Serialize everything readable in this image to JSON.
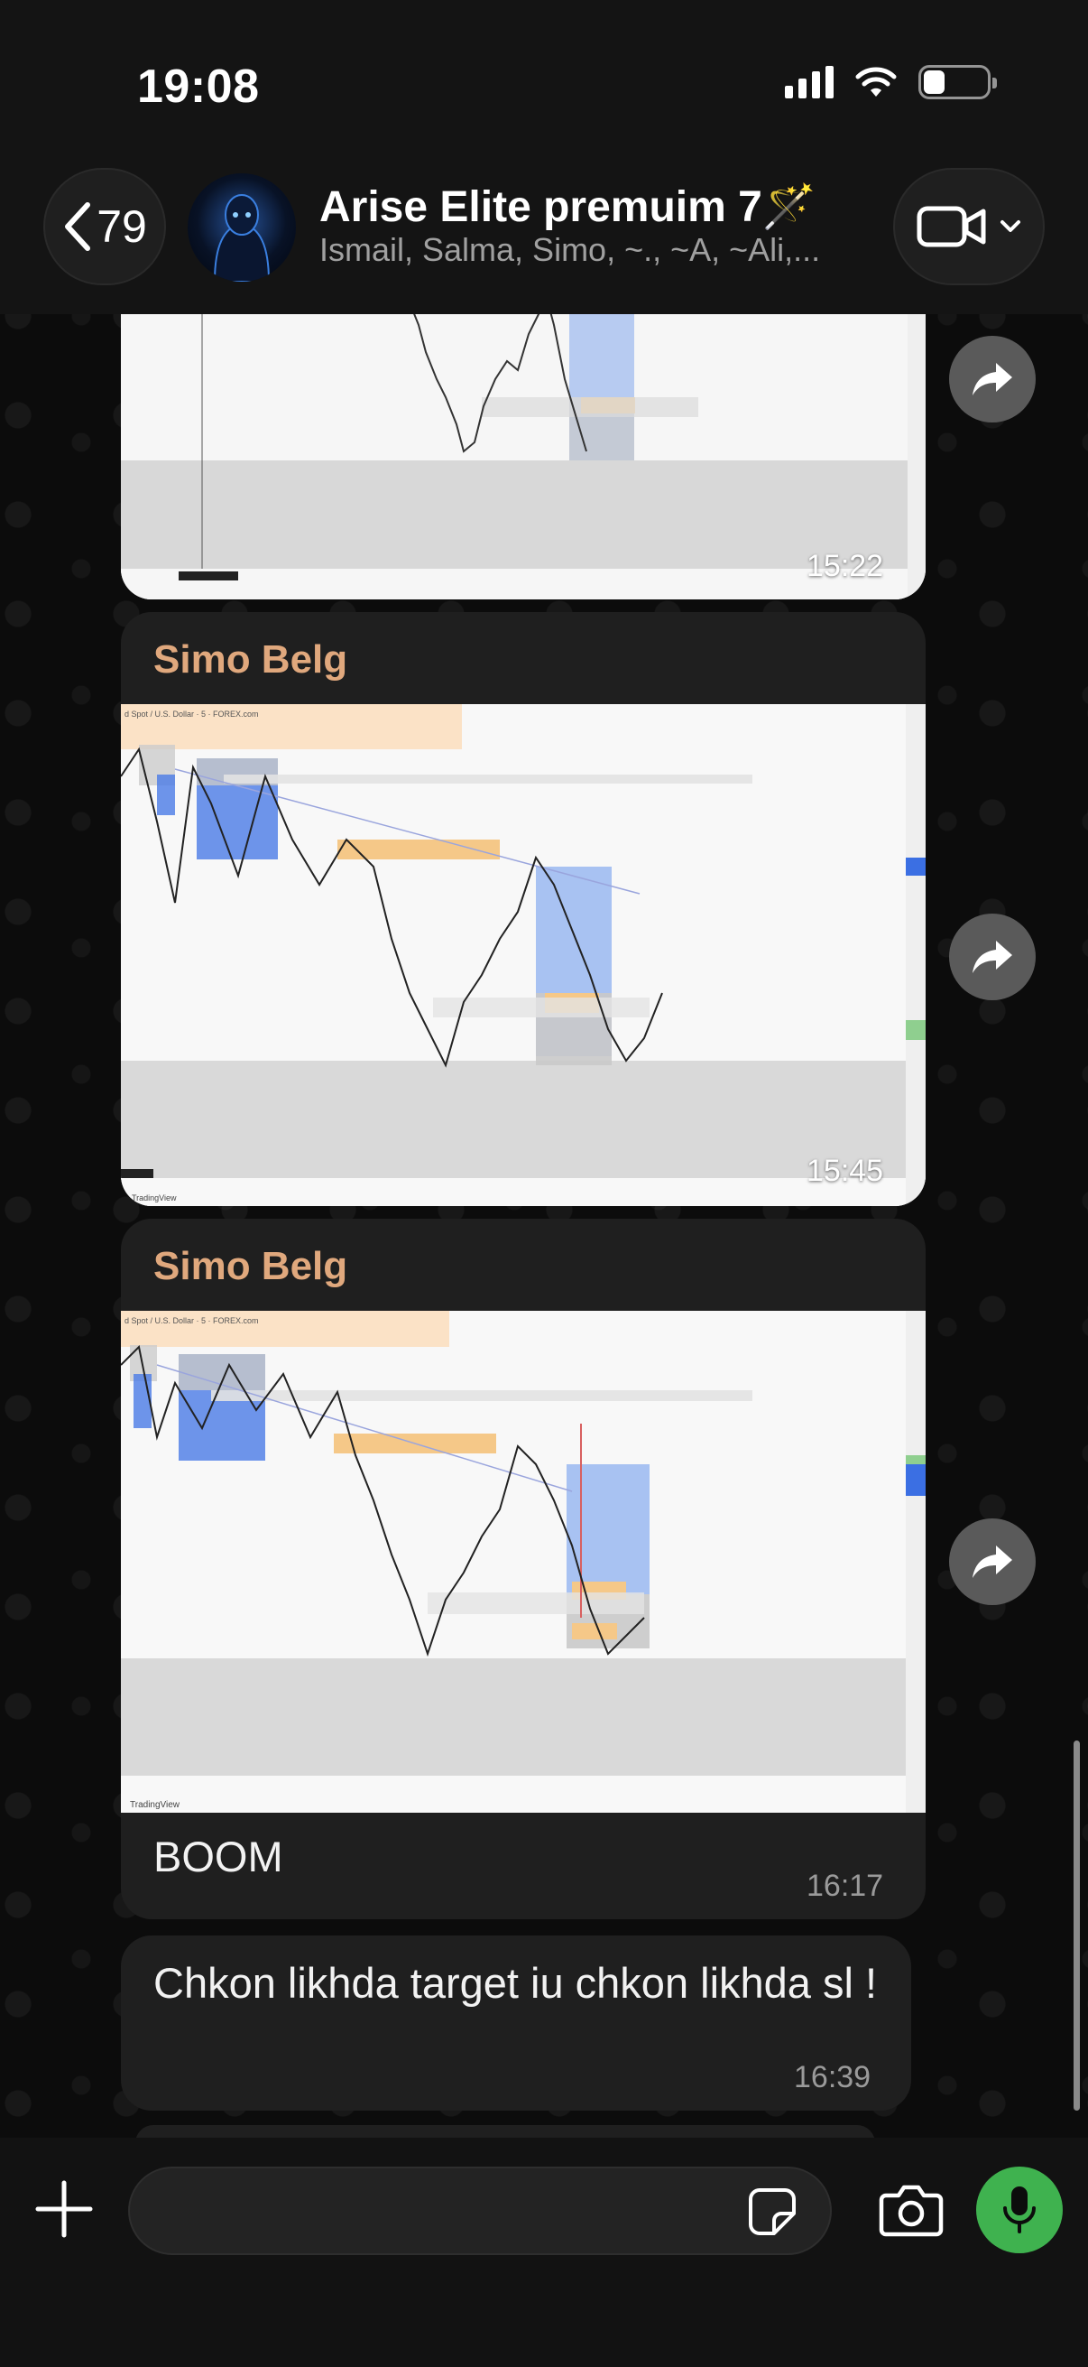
{
  "status_bar": {
    "time": "19:08"
  },
  "header": {
    "back_count": "79",
    "group_title": "Arise Elite premuim 7🪄",
    "members": "Ismail, Salma, Simo, ~., ~A, ~Ali,..."
  },
  "messages": [
    {
      "type": "image",
      "time": "15:22"
    },
    {
      "type": "image",
      "sender": "Simo Belg",
      "time": "15:45",
      "chart_caption": "d Spot / U.S. Dollar · 5 · FOREX.com",
      "watermark": "TradingView"
    },
    {
      "type": "image",
      "sender": "Simo Belg",
      "caption": "BOOM",
      "time": "16:17",
      "chart_caption": "d Spot / U.S. Dollar · 5 · FOREX.com",
      "watermark": "TradingView"
    },
    {
      "type": "text",
      "text": "Chkon likhda target iu chkon likhda sl !",
      "time": "16:39"
    }
  ],
  "colors": {
    "sender": "#e0a87d",
    "mic": "#3fb24f",
    "bubble": "#1f1f1f"
  },
  "icons": [
    "chevron-left-icon",
    "video-icon",
    "forward-icon",
    "plus-icon",
    "sticker-icon",
    "camera-icon",
    "microphone-icon"
  ]
}
